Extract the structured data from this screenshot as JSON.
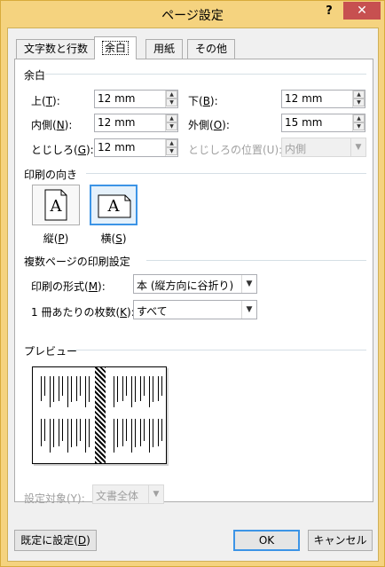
{
  "window": {
    "title": "ページ設定",
    "help_label": "?",
    "close_label": "✕"
  },
  "tabs": [
    {
      "label": "文字数と行数"
    },
    {
      "label": "余白"
    },
    {
      "label": "用紙"
    },
    {
      "label": "その他"
    }
  ],
  "margins": {
    "group_title": "余白",
    "top": {
      "label": "上(",
      "key": "T",
      "suffix": "):",
      "value": "12 mm"
    },
    "bottom": {
      "label": "下(",
      "key": "B",
      "suffix": "):",
      "value": "12 mm"
    },
    "inside": {
      "label": "内側(",
      "key": "N",
      "suffix": "):",
      "value": "12 mm"
    },
    "outside": {
      "label": "外側(",
      "key": "O",
      "suffix": "):",
      "value": "15 mm"
    },
    "gutter": {
      "label": "とじしろ(",
      "key": "G",
      "suffix": "):",
      "value": "12 mm"
    },
    "gutter_position": {
      "label": "とじしろの位置(U):",
      "value": "内側"
    }
  },
  "orientation": {
    "group_title": "印刷の向き",
    "portrait": {
      "label": "縦(",
      "key": "P",
      "suffix": ")",
      "glyph": "A"
    },
    "landscape": {
      "label": "横(",
      "key": "S",
      "suffix": ")",
      "glyph": "A"
    }
  },
  "pages": {
    "group_title": "複数ページの印刷設定",
    "format": {
      "label": "印刷の形式(",
      "key": "M",
      "suffix": "):",
      "value": "本 (縦方向に谷折り)"
    },
    "sheets": {
      "label": "1 冊あたりの枚数(",
      "key": "K",
      "suffix": "):",
      "value": "すべて"
    }
  },
  "preview": {
    "group_title": "プレビュー",
    "apply_to": {
      "label": "設定対象(Y):",
      "value": "文書全体"
    }
  },
  "buttons": {
    "default_label": "既定に設定(",
    "default_key": "D",
    "default_suffix": ")",
    "ok": "OK",
    "cancel": "キャンセル"
  },
  "icons": {
    "spin_up": "spin-up-arrow-icon",
    "spin_down": "spin-down-arrow-icon",
    "dropdown": "chevron-down-icon",
    "portrait_page": "portrait-page-icon",
    "landscape_page": "landscape-page-icon"
  }
}
